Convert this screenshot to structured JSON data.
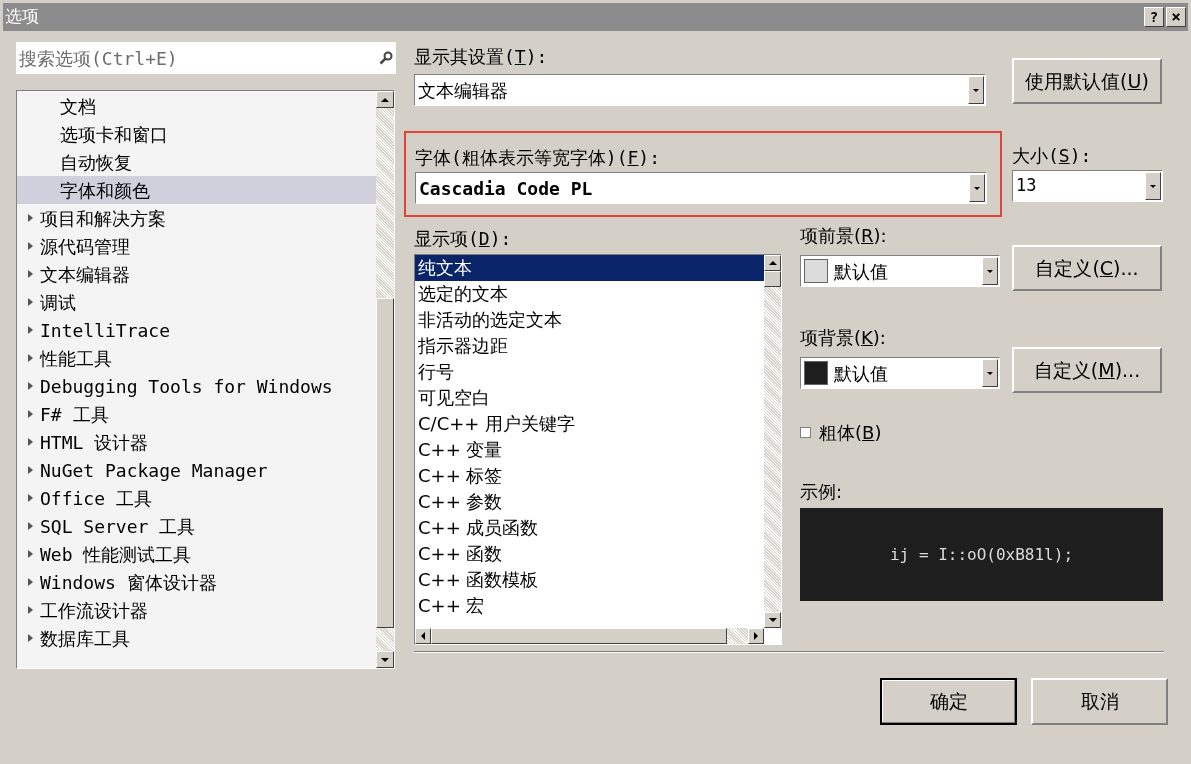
{
  "window": {
    "title": "选项",
    "help": "?",
    "close": "×"
  },
  "search": {
    "placeholder": "搜索选项(Ctrl+E)"
  },
  "tree": {
    "items": [
      {
        "label": "文档",
        "expandable": false,
        "selected": false
      },
      {
        "label": "选项卡和窗口",
        "expandable": false,
        "selected": false
      },
      {
        "label": "自动恢复",
        "expandable": false,
        "selected": false
      },
      {
        "label": "字体和颜色",
        "expandable": false,
        "selected": true
      },
      {
        "label": "项目和解决方案",
        "expandable": true,
        "selected": false
      },
      {
        "label": "源代码管理",
        "expandable": true,
        "selected": false
      },
      {
        "label": "文本编辑器",
        "expandable": true,
        "selected": false
      },
      {
        "label": "调试",
        "expandable": true,
        "selected": false
      },
      {
        "label": "IntelliTrace",
        "expandable": true,
        "selected": false
      },
      {
        "label": "性能工具",
        "expandable": true,
        "selected": false
      },
      {
        "label": "Debugging Tools for Windows",
        "expandable": true,
        "selected": false
      },
      {
        "label": "F# 工具",
        "expandable": true,
        "selected": false
      },
      {
        "label": "HTML 设计器",
        "expandable": true,
        "selected": false
      },
      {
        "label": "NuGet Package Manager",
        "expandable": true,
        "selected": false
      },
      {
        "label": "Office 工具",
        "expandable": true,
        "selected": false
      },
      {
        "label": "SQL Server 工具",
        "expandable": true,
        "selected": false
      },
      {
        "label": "Web 性能测试工具",
        "expandable": true,
        "selected": false
      },
      {
        "label": "Windows 窗体设计器",
        "expandable": true,
        "selected": false
      },
      {
        "label": "工作流设计器",
        "expandable": true,
        "selected": false
      },
      {
        "label": "数据库工具",
        "expandable": true,
        "selected": false
      }
    ]
  },
  "show_settings_for": {
    "label": [
      "显示其设置(",
      "T",
      "):"
    ],
    "value": "文本编辑器"
  },
  "use_defaults_button": [
    "使用默认值(",
    "U",
    ")"
  ],
  "font": {
    "label": [
      "字体(粗体表示等宽字体)(",
      "F",
      "):"
    ],
    "value": "Cascadia Code PL",
    "highlighted": true
  },
  "size": {
    "label": [
      "大小(",
      "S",
      "):"
    ],
    "value": "13"
  },
  "display_items": {
    "label": [
      "显示项(",
      "D",
      "):"
    ],
    "items": [
      {
        "label": "纯文本",
        "selected": true
      },
      {
        "label": "选定的文本",
        "selected": false
      },
      {
        "label": "非活动的选定文本",
        "selected": false
      },
      {
        "label": "指示器边距",
        "selected": false
      },
      {
        "label": "行号",
        "selected": false
      },
      {
        "label": "可见空白",
        "selected": false
      },
      {
        "label": "C/C++ 用户关键字",
        "selected": false
      },
      {
        "label": "C++ 变量",
        "selected": false
      },
      {
        "label": "C++ 标签",
        "selected": false
      },
      {
        "label": "C++ 参数",
        "selected": false
      },
      {
        "label": "C++ 成员函数",
        "selected": false
      },
      {
        "label": "C++ 函数",
        "selected": false
      },
      {
        "label": "C++ 函数模板",
        "selected": false
      },
      {
        "label": "C++ 宏",
        "selected": false
      }
    ]
  },
  "foreground": {
    "label": [
      "项前景(",
      "R",
      "):"
    ],
    "value": "默认值",
    "color": "#dcdcdc",
    "button": [
      "自定义(",
      "C",
      ")..."
    ]
  },
  "background": {
    "label": [
      "项背景(",
      "K",
      "):"
    ],
    "value": "默认值",
    "color": "#1e1e1e",
    "button": [
      "自定义(",
      "M",
      ")..."
    ]
  },
  "bold": {
    "label": [
      "粗体(",
      "B",
      ")"
    ],
    "checked": false
  },
  "sample": {
    "label": "示例:",
    "text": "ij = I::oO(0xB81l);"
  },
  "buttons": [
    "确定",
    "取消"
  ]
}
